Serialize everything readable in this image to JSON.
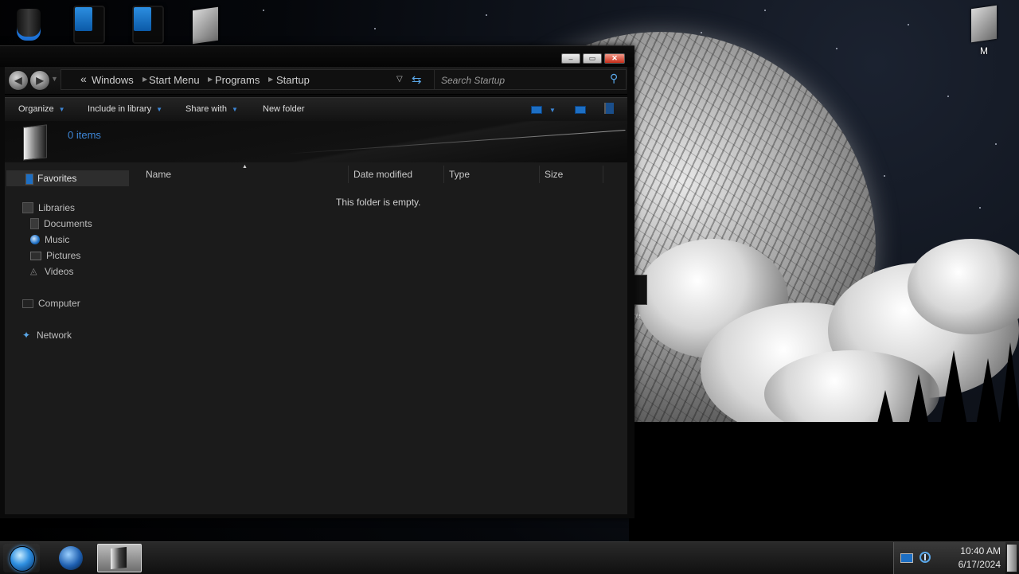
{
  "desktop": {
    "label_m": "M",
    "gadget_label": "re"
  },
  "window": {
    "caption": {
      "minimize": "–",
      "maximize": "▭",
      "close": "✕"
    },
    "navigation": {
      "back_icon": "arrow-left-icon",
      "forward_icon": "arrow-right-icon",
      "breadcrumb_overflow": "«",
      "breadcrumb": [
        "Windows",
        "Start Menu",
        "Programs",
        "Startup"
      ],
      "search_placeholder": "Search Startup"
    },
    "toolbar": {
      "organize": "Organize",
      "include_in_library": "Include in library",
      "share_with": "Share with",
      "new_folder": "New folder"
    },
    "details": {
      "item_count": "0 items"
    },
    "nav_pane": {
      "favorites": "Favorites",
      "libraries": "Libraries",
      "documents": "Documents",
      "music": "Music",
      "pictures": "Pictures",
      "videos": "Videos",
      "computer": "Computer",
      "network": "Network"
    },
    "columns": [
      "Name",
      "Date modified",
      "Type",
      "Size"
    ],
    "empty_message": "This folder is empty."
  },
  "taskbar": {
    "clock_time": "10:40 AM",
    "clock_date": "6/17/2024"
  },
  "colors": {
    "accent": "#3d86d6",
    "window_bg": "#1b1b1b",
    "close_button": "#c62d1a"
  }
}
